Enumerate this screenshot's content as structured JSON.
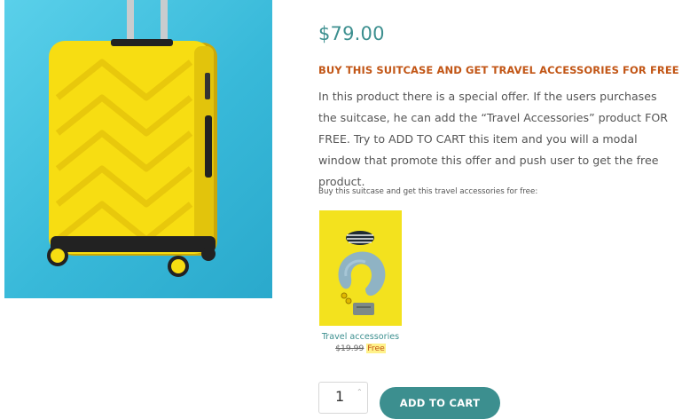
{
  "product": {
    "price": "$79.00",
    "promo_heading": "BUY THIS SUITCASE AND GET TRAVEL ACCESSORIES FOR FREE",
    "description": "In this product there is a special offer. If the users purchases the suitcase, he can add the “Travel Accessories” product FOR FREE. Try to ADD TO CART this item and you will a modal window that promote this offer and push user to get the free product."
  },
  "offer": {
    "caption": "Buy this suitcase and get this travel accessories for free:",
    "item": {
      "name": "Travel accessories",
      "old_price": "$19.99",
      "new_price": "Free"
    }
  },
  "cart": {
    "quantity": "1",
    "add_to_cart_label": "ADD TO CART"
  },
  "colors": {
    "accent": "#3c8f8f",
    "promo": "#c25616",
    "suitcase_yellow": "#f7dd12",
    "background_cyan": "#38b9d9"
  },
  "icons": {
    "qty_up": "chevron-up-icon"
  }
}
